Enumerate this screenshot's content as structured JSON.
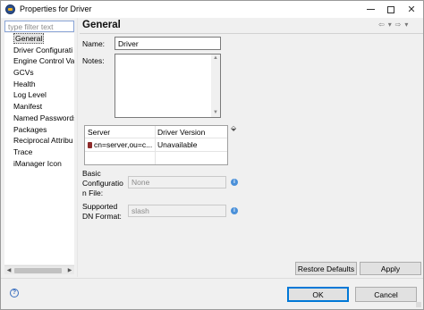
{
  "window": {
    "title": "Properties for Driver",
    "controls": {
      "minimize_icon": "minimize-icon",
      "maximize_icon": "maximize-icon",
      "close_icon": "close-icon"
    }
  },
  "filter": {
    "placeholder": "type filter text",
    "value": ""
  },
  "tree": {
    "items": [
      {
        "label": "General",
        "selected": true
      },
      {
        "label": "Driver Configurati"
      },
      {
        "label": "Engine Control Va"
      },
      {
        "label": "GCVs"
      },
      {
        "label": "Health"
      },
      {
        "label": "Log Level"
      },
      {
        "label": "Manifest"
      },
      {
        "label": "Named Passwords"
      },
      {
        "label": "Packages"
      },
      {
        "label": "Reciprocal Attribu"
      },
      {
        "label": "Trace"
      },
      {
        "label": "iManager Icon"
      }
    ]
  },
  "page": {
    "title": "General",
    "name_label": "Name:",
    "name_value": "Driver",
    "notes_label": "Notes:",
    "notes_value": "",
    "table": {
      "columns": [
        "Server",
        "Driver Version"
      ],
      "rows": [
        {
          "server": "cn=server,ou=c...",
          "version": "Unavailable"
        }
      ]
    },
    "basic_config_label_1": "Basic",
    "basic_config_label_2": "Configuratio",
    "basic_config_label_3": "n File:",
    "basic_config_value": "None",
    "supported_dn_label_1": "Supported",
    "supported_dn_label_2": "DN Format:",
    "supported_dn_value": "slash"
  },
  "buttons": {
    "restore_defaults": "Restore Defaults",
    "apply": "Apply",
    "ok": "OK",
    "cancel": "Cancel"
  },
  "colors": {
    "accent": "#0078d7",
    "focus": "#8aa5d6",
    "help": "#4a90d9"
  }
}
